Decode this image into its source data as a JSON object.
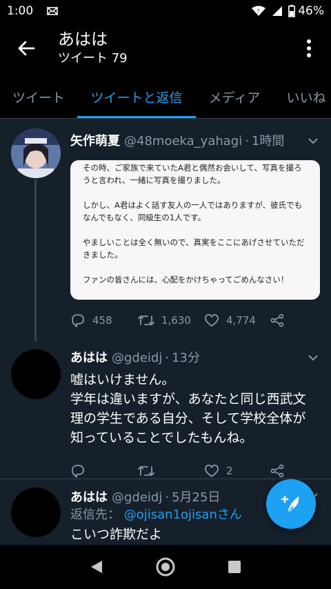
{
  "status": {
    "time": "1:00",
    "battery": "46%"
  },
  "header": {
    "title": "あはは",
    "subtitle": "ツイート 79"
  },
  "tabs": [
    {
      "label": "ツイート",
      "active": false
    },
    {
      "label": "ツイートと返信",
      "active": true
    },
    {
      "label": "メディア",
      "active": false
    },
    {
      "label": "いいね",
      "active": false
    }
  ],
  "tweets": [
    {
      "display_name": "矢作萌夏",
      "handle": "@48moeka_yahagi",
      "time": "1時間",
      "image_text": {
        "cut_line": "",
        "line1": "その時、ご家族で来ていたA君と偶然お会いして、写真を撮ろうと言われ、一緒に写真を撮りました。",
        "line2": "しかし、A君はよく話す友人の一人ではありますが、彼氏でもなんでもなく、同級生の1人です。",
        "line3": "やましいことは全く無いので、真実をここにあげさせていただきました。",
        "line4": "ファンの皆さんには、心配をかけちゃってごめんなさい！"
      },
      "replies": "458",
      "retweets": "1,630",
      "likes": "4,774"
    },
    {
      "display_name": "あはは",
      "handle": "@gdeidj",
      "time": "13分",
      "text_line1": "嘘はいけません。",
      "text_line2": "学年は違いますが、あなたと同じ西武文",
      "text_line3": "理の学生である自分、そして学校全体が",
      "text_line4": "知っていることでしたもんね。",
      "replies": "",
      "retweets": "",
      "likes": "2"
    },
    {
      "display_name": "あはは",
      "handle": "@gdeidj",
      "time": "5月25日",
      "reply_prefix": "返信先：",
      "reply_target": "@ojisan1ojisanさん",
      "text_line1": "こいつ詐欺だよ"
    }
  ],
  "icons": {
    "back": "arrow-left-icon",
    "more": "more-vertical-icon",
    "compose": "compose-feather-icon"
  },
  "colors": {
    "accent": "#1da1f2",
    "background": "#15202b",
    "muted": "#8899a6"
  }
}
